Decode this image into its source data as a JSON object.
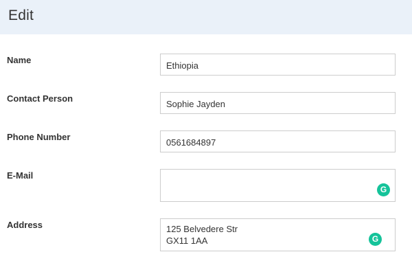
{
  "header": {
    "title": "Edit"
  },
  "form": {
    "name": {
      "label": "Name",
      "value": "Ethiopia"
    },
    "contact_person": {
      "label": "Contact Person",
      "value": "Sophie Jayden"
    },
    "phone_number": {
      "label": "Phone Number",
      "value": "0561684897"
    },
    "email": {
      "label": "E-Mail",
      "value": ""
    },
    "address": {
      "label": "Address",
      "line1": "125 Belvedere Str",
      "line2": "GX11 1AA"
    }
  },
  "icons": {
    "grammarly": "grammarly-icon"
  },
  "colors": {
    "header_bg": "#eaf1f9",
    "grammarly": "#15c39a",
    "border": "#cccccc"
  }
}
